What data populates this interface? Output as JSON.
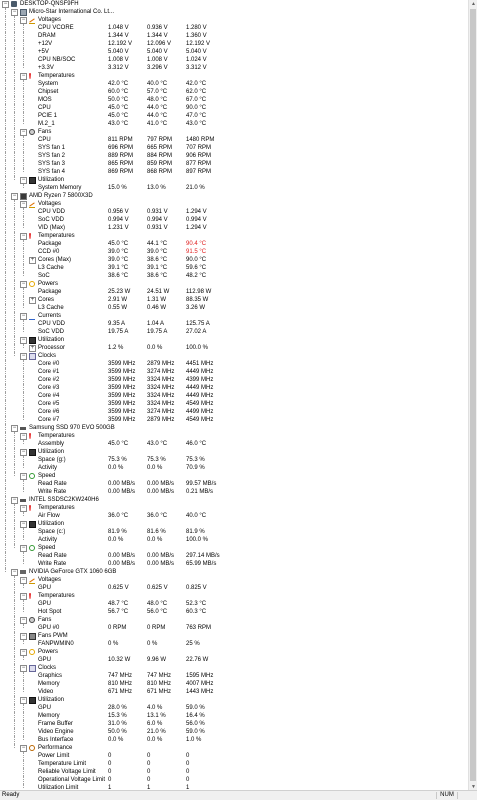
{
  "statusbar": {
    "status": "Ready",
    "num": "NUM"
  },
  "tree": [
    {
      "d": 0,
      "exp": "-",
      "icon": "computer",
      "label": "DESKTOP-QNSF9FH"
    },
    {
      "d": 1,
      "exp": "-",
      "icon": "board",
      "label": "Micro-Star International Co. Lt..."
    },
    {
      "d": 2,
      "exp": "-",
      "icon": "volt",
      "label": "Voltages"
    },
    {
      "d": 3,
      "label": "CPU VCORE",
      "v": [
        "1.048 V",
        "0.936 V",
        "1.280 V"
      ]
    },
    {
      "d": 3,
      "label": "DRAM",
      "v": [
        "1.344 V",
        "1.344 V",
        "1.360 V"
      ]
    },
    {
      "d": 3,
      "label": "+12V",
      "v": [
        "12.192 V",
        "12.096 V",
        "12.192 V"
      ]
    },
    {
      "d": 3,
      "label": "+5V",
      "v": [
        "5.040 V",
        "5.040 V",
        "5.040 V"
      ]
    },
    {
      "d": 3,
      "label": "CPU NB/SOC",
      "v": [
        "1.008 V",
        "1.008 V",
        "1.024 V"
      ]
    },
    {
      "d": 3,
      "label": "+3.3V",
      "v": [
        "3.312 V",
        "3.296 V",
        "3.312 V"
      ]
    },
    {
      "d": 2,
      "exp": "-",
      "icon": "temp",
      "label": "Temperatures"
    },
    {
      "d": 3,
      "label": "System",
      "v": [
        "42.0 °C",
        "40.0 °C",
        "42.0 °C"
      ]
    },
    {
      "d": 3,
      "label": "Chipset",
      "v": [
        "60.0 °C",
        "57.0 °C",
        "62.0 °C"
      ]
    },
    {
      "d": 3,
      "label": "MOS",
      "v": [
        "50.0 °C",
        "48.0 °C",
        "67.0 °C"
      ]
    },
    {
      "d": 3,
      "label": "CPU",
      "v": [
        "45.0 °C",
        "44.0 °C",
        "90.0 °C"
      ]
    },
    {
      "d": 3,
      "label": "PCIE 1",
      "v": [
        "45.0 °C",
        "44.0 °C",
        "47.0 °C"
      ]
    },
    {
      "d": 3,
      "label": "M.2_1",
      "v": [
        "43.0 °C",
        "41.0 °C",
        "43.0 °C"
      ]
    },
    {
      "d": 2,
      "exp": "-",
      "icon": "fan",
      "label": "Fans"
    },
    {
      "d": 3,
      "label": "CPU",
      "v": [
        "811 RPM",
        "797 RPM",
        "1480 RPM"
      ]
    },
    {
      "d": 3,
      "label": "SYS fan 1",
      "v": [
        "696 RPM",
        "665 RPM",
        "707 RPM"
      ]
    },
    {
      "d": 3,
      "label": "SYS fan 2",
      "v": [
        "889 RPM",
        "884 RPM",
        "906 RPM"
      ]
    },
    {
      "d": 3,
      "label": "SYS fan 3",
      "v": [
        "865 RPM",
        "859 RPM",
        "877 RPM"
      ]
    },
    {
      "d": 3,
      "label": "SYS fan 4",
      "v": [
        "869 RPM",
        "868 RPM",
        "897 RPM"
      ]
    },
    {
      "d": 2,
      "exp": "-",
      "icon": "util",
      "label": "Utilization"
    },
    {
      "d": 3,
      "label": "System Memory",
      "v": [
        "15.0 %",
        "13.0 %",
        "21.0 %"
      ]
    },
    {
      "d": 1,
      "exp": "-",
      "icon": "chip",
      "label": "AMD Ryzen 7 5800X3D"
    },
    {
      "d": 2,
      "exp": "-",
      "icon": "volt",
      "label": "Voltages"
    },
    {
      "d": 3,
      "label": "CPU VDD",
      "v": [
        "0.956 V",
        "0.931 V",
        "1.294 V"
      ]
    },
    {
      "d": 3,
      "label": "SoC VDD",
      "v": [
        "0.994 V",
        "0.994 V",
        "0.994 V"
      ]
    },
    {
      "d": 3,
      "label": "VID (Max)",
      "v": [
        "1.231 V",
        "0.931 V",
        "1.294 V"
      ]
    },
    {
      "d": 2,
      "exp": "-",
      "icon": "temp",
      "label": "Temperatures"
    },
    {
      "d": 3,
      "label": "Package",
      "v": [
        "45.0 °C",
        "44.1 °C",
        "90.4 °C"
      ],
      "red": [
        2
      ]
    },
    {
      "d": 3,
      "label": "CCD #0",
      "v": [
        "39.0 °C",
        "39.0 °C",
        "91.5 °C"
      ],
      "red": [
        2
      ]
    },
    {
      "d": 3,
      "exp": "+",
      "label": "Cores (Max)",
      "v": [
        "39.0 °C",
        "38.6 °C",
        "90.0 °C"
      ]
    },
    {
      "d": 3,
      "label": "L3 Cache",
      "v": [
        "39.1 °C",
        "39.1 °C",
        "59.6 °C"
      ]
    },
    {
      "d": 3,
      "label": "SoC",
      "v": [
        "38.6 °C",
        "38.6 °C",
        "48.2 °C"
      ]
    },
    {
      "d": 2,
      "exp": "-",
      "icon": "power",
      "label": "Powers"
    },
    {
      "d": 3,
      "label": "Package",
      "v": [
        "25.23 W",
        "24.51 W",
        "112.98 W"
      ]
    },
    {
      "d": 3,
      "exp": "+",
      "label": "Cores",
      "v": [
        "2.91 W",
        "1.31 W",
        "88.35 W"
      ]
    },
    {
      "d": 3,
      "label": "L3 Cache",
      "v": [
        "0.55 W",
        "0.46 W",
        "3.26 W"
      ]
    },
    {
      "d": 2,
      "exp": "-",
      "icon": "current",
      "label": "Currents"
    },
    {
      "d": 3,
      "label": "CPU VDD",
      "v": [
        "9.35 A",
        "1.04 A",
        "125.75 A"
      ]
    },
    {
      "d": 3,
      "label": "SoC VDD",
      "v": [
        "19.75 A",
        "19.75 A",
        "27.02 A"
      ]
    },
    {
      "d": 2,
      "exp": "-",
      "icon": "util",
      "label": "Utilization"
    },
    {
      "d": 3,
      "exp": "+",
      "label": "Processor",
      "v": [
        "1.2 %",
        "0.0 %",
        "100.0 %"
      ]
    },
    {
      "d": 2,
      "exp": "-",
      "icon": "clock",
      "label": "Clocks"
    },
    {
      "d": 3,
      "label": "Core #0",
      "v": [
        "3599 MHz",
        "2879 MHz",
        "4451 MHz"
      ]
    },
    {
      "d": 3,
      "label": "Core #1",
      "v": [
        "3599 MHz",
        "3274 MHz",
        "4449 MHz"
      ]
    },
    {
      "d": 3,
      "label": "Core #2",
      "v": [
        "3599 MHz",
        "3324 MHz",
        "4399 MHz"
      ]
    },
    {
      "d": 3,
      "label": "Core #3",
      "v": [
        "3599 MHz",
        "3324 MHz",
        "4449 MHz"
      ]
    },
    {
      "d": 3,
      "label": "Core #4",
      "v": [
        "3599 MHz",
        "3324 MHz",
        "4449 MHz"
      ]
    },
    {
      "d": 3,
      "label": "Core #5",
      "v": [
        "3599 MHz",
        "3324 MHz",
        "4549 MHz"
      ]
    },
    {
      "d": 3,
      "label": "Core #6",
      "v": [
        "3599 MHz",
        "3274 MHz",
        "4499 MHz"
      ]
    },
    {
      "d": 3,
      "label": "Core #7",
      "v": [
        "3599 MHz",
        "2879 MHz",
        "4549 MHz"
      ]
    },
    {
      "d": 1,
      "exp": "-",
      "icon": "drive",
      "label": "Samsung SSD 970 EVO 500GB"
    },
    {
      "d": 2,
      "exp": "-",
      "icon": "temp",
      "label": "Temperatures"
    },
    {
      "d": 3,
      "label": "Assembly",
      "v": [
        "45.0 °C",
        "43.0 °C",
        "46.0 °C"
      ]
    },
    {
      "d": 2,
      "exp": "-",
      "icon": "util",
      "label": "Utilization"
    },
    {
      "d": 3,
      "label": "Space (g:)",
      "v": [
        "75.3 %",
        "75.3 %",
        "75.3 %"
      ]
    },
    {
      "d": 3,
      "label": "Activity",
      "v": [
        "0.0 %",
        "0.0 %",
        "70.9 %"
      ]
    },
    {
      "d": 2,
      "exp": "-",
      "icon": "speed",
      "label": "Speed"
    },
    {
      "d": 3,
      "label": "Read Rate",
      "v": [
        "0.00 MB/s",
        "0.00 MB/s",
        "99.57 MB/s"
      ]
    },
    {
      "d": 3,
      "label": "Write Rate",
      "v": [
        "0.00 MB/s",
        "0.00 MB/s",
        "0.21 MB/s"
      ]
    },
    {
      "d": 1,
      "exp": "-",
      "icon": "drive",
      "label": "INTEL SSDSC2KW240H6"
    },
    {
      "d": 2,
      "exp": "-",
      "icon": "temp",
      "label": "Temperatures"
    },
    {
      "d": 3,
      "label": "Air Flow",
      "v": [
        "36.0 °C",
        "36.0 °C",
        "40.0 °C"
      ]
    },
    {
      "d": 2,
      "exp": "-",
      "icon": "util",
      "label": "Utilization"
    },
    {
      "d": 3,
      "label": "Space (c:)",
      "v": [
        "81.9 %",
        "81.6 %",
        "81.9 %"
      ]
    },
    {
      "d": 3,
      "label": "Activity",
      "v": [
        "0.0 %",
        "0.0 %",
        "100.0 %"
      ]
    },
    {
      "d": 2,
      "exp": "-",
      "icon": "speed",
      "label": "Speed"
    },
    {
      "d": 3,
      "label": "Read Rate",
      "v": [
        "0.00 MB/s",
        "0.00 MB/s",
        "297.14 MB/s"
      ]
    },
    {
      "d": 3,
      "label": "Write Rate",
      "v": [
        "0.00 MB/s",
        "0.00 MB/s",
        "65.99 MB/s"
      ]
    },
    {
      "d": 1,
      "exp": "-",
      "icon": "gpu",
      "label": "NVIDIA GeForce GTX 1060 6GB"
    },
    {
      "d": 2,
      "exp": "-",
      "icon": "volt",
      "label": "Voltages"
    },
    {
      "d": 3,
      "label": "GPU",
      "v": [
        "0.625 V",
        "0.625 V",
        "0.825 V"
      ]
    },
    {
      "d": 2,
      "exp": "-",
      "icon": "temp",
      "label": "Temperatures"
    },
    {
      "d": 3,
      "label": "GPU",
      "v": [
        "48.7 °C",
        "48.0 °C",
        "52.3 °C"
      ]
    },
    {
      "d": 3,
      "label": "Hot Spot",
      "v": [
        "56.7 °C",
        "56.0 °C",
        "60.3 °C"
      ]
    },
    {
      "d": 2,
      "exp": "-",
      "icon": "fan",
      "label": "Fans"
    },
    {
      "d": 3,
      "label": "GPU #0",
      "v": [
        "0 RPM",
        "0 RPM",
        "763 RPM"
      ]
    },
    {
      "d": 2,
      "exp": "-",
      "icon": "fanpwm",
      "label": "Fans PWM"
    },
    {
      "d": 3,
      "label": "FANPWMIN0",
      "v": [
        "0 %",
        "0 %",
        "25 %"
      ]
    },
    {
      "d": 2,
      "exp": "-",
      "icon": "power",
      "label": "Powers"
    },
    {
      "d": 3,
      "label": "GPU",
      "v": [
        "10.32 W",
        "9.96 W",
        "22.76 W"
      ]
    },
    {
      "d": 2,
      "exp": "-",
      "icon": "clock",
      "label": "Clocks"
    },
    {
      "d": 3,
      "label": "Graphics",
      "v": [
        "747 MHz",
        "747 MHz",
        "1595 MHz"
      ]
    },
    {
      "d": 3,
      "label": "Memory",
      "v": [
        "810 MHz",
        "810 MHz",
        "4007 MHz"
      ]
    },
    {
      "d": 3,
      "label": "Video",
      "v": [
        "671 MHz",
        "671 MHz",
        "1443 MHz"
      ]
    },
    {
      "d": 2,
      "exp": "-",
      "icon": "util",
      "label": "Utilization"
    },
    {
      "d": 3,
      "label": "GPU",
      "v": [
        "28.0 %",
        "4.0 %",
        "59.0 %"
      ]
    },
    {
      "d": 3,
      "label": "Memory",
      "v": [
        "15.3 %",
        "13.1 %",
        "16.4 %"
      ]
    },
    {
      "d": 3,
      "label": "Frame Buffer",
      "v": [
        "31.0 %",
        "6.0 %",
        "56.0 %"
      ]
    },
    {
      "d": 3,
      "label": "Video Engine",
      "v": [
        "50.0 %",
        "21.0 %",
        "59.0 %"
      ]
    },
    {
      "d": 3,
      "label": "Bus Interface",
      "v": [
        "0.0 %",
        "0.0 %",
        "1.0 %"
      ]
    },
    {
      "d": 2,
      "exp": "-",
      "icon": "perf",
      "label": "Performance"
    },
    {
      "d": 3,
      "label": "Power Limit",
      "v": [
        "0",
        "0",
        "0"
      ]
    },
    {
      "d": 3,
      "label": "Temperature Limit",
      "v": [
        "0",
        "0",
        "0"
      ]
    },
    {
      "d": 3,
      "label": "Reliable Voltage Limit",
      "v": [
        "0",
        "0",
        "0"
      ]
    },
    {
      "d": 3,
      "label": "Operational Voltage Limit",
      "v": [
        "0",
        "0",
        "0"
      ]
    },
    {
      "d": 3,
      "label": "Utilization Limit",
      "v": [
        "1",
        "1",
        "1"
      ]
    }
  ]
}
